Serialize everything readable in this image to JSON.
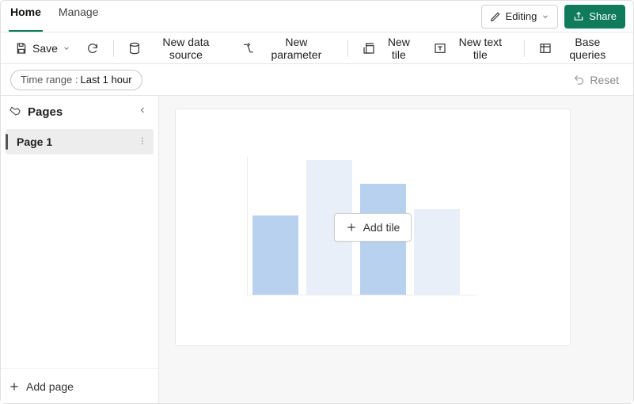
{
  "tabs": [
    "Home",
    "Manage"
  ],
  "header": {
    "editing": "Editing",
    "share": "Share"
  },
  "toolbar": {
    "save": "Save",
    "newDataSource": "New data source",
    "newParameter": "New parameter",
    "newTile": "New tile",
    "newTextTile": "New text tile",
    "baseQueries": "Base queries"
  },
  "filters": {
    "timeRange": {
      "label": "Time range :",
      "value": "Last 1 hour"
    },
    "reset": "Reset"
  },
  "sidebar": {
    "title": "Pages",
    "pages": [
      "Page 1"
    ],
    "addPage": "Add page"
  },
  "canvas": {
    "addTile": "Add tile"
  },
  "colors": {
    "accent": "#0f7b5a",
    "barLight": "#e8eff9",
    "barMed": "#b7d1ee"
  }
}
